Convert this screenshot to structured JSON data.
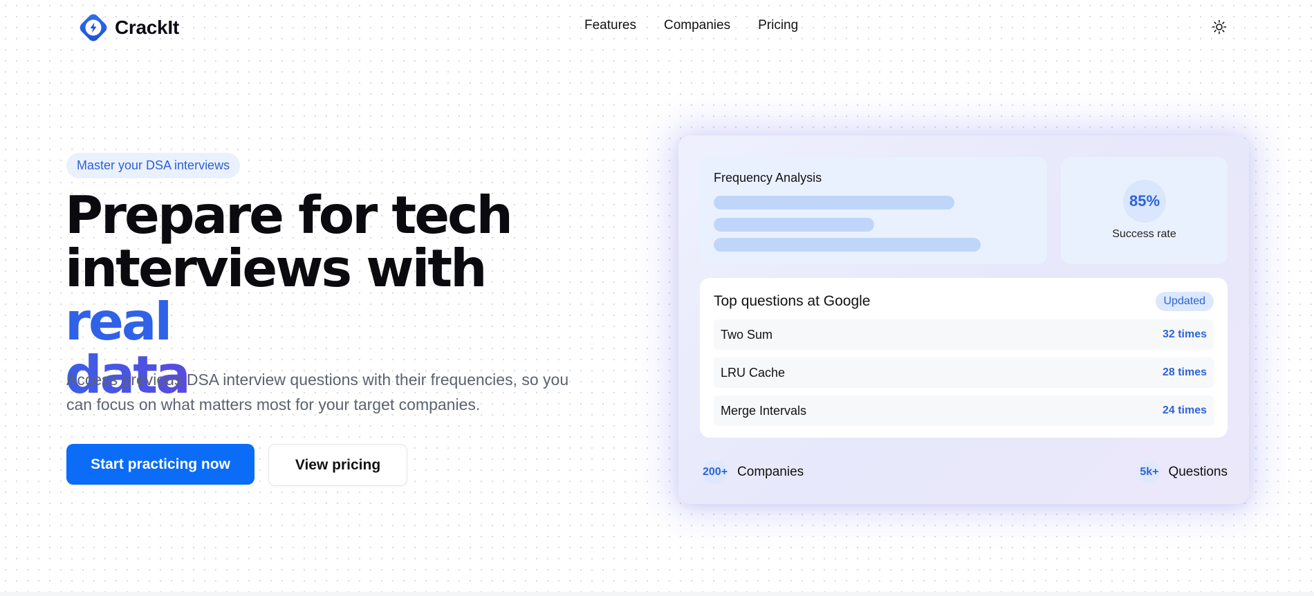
{
  "nav": {
    "brand": "CrackIt",
    "links": [
      "Features",
      "Companies",
      "Pricing"
    ]
  },
  "hero": {
    "badge": "Master your DSA interviews",
    "headline_line1": "Prepare for tech",
    "headline_line2": "interviews with ",
    "headline_highlight1": "real",
    "headline_highlight2": "data",
    "subtext": "Access previous DSA interview questions with their frequencies, so you can focus on what matters most for your target companies.",
    "primary_button": "Start practicing now",
    "secondary_button": "View pricing"
  },
  "card": {
    "frequency_title": "Frequency Analysis",
    "frequency_bars": [
      0.74,
      0.49,
      0.82
    ],
    "success_value": "85%",
    "success_label": "Success rate",
    "questions_title": "Top questions at Google",
    "questions_badge": "Updated",
    "questions": [
      {
        "name": "Two Sum",
        "count": "32 times"
      },
      {
        "name": "LRU Cache",
        "count": "28 times"
      },
      {
        "name": "Merge Intervals",
        "count": "24 times"
      }
    ],
    "stats": [
      {
        "value": "200+",
        "label": "Companies"
      },
      {
        "value": "5k+",
        "label": "Questions"
      }
    ]
  },
  "colors": {
    "primary": "#0a6cf7",
    "accent_blue": "#2f62e8",
    "accent_indigo": "#5a4ae0",
    "badge_bg": "#eaf1fe"
  },
  "icons": {
    "logo": "lightning-badge-icon",
    "theme_toggle": "sun-icon"
  }
}
